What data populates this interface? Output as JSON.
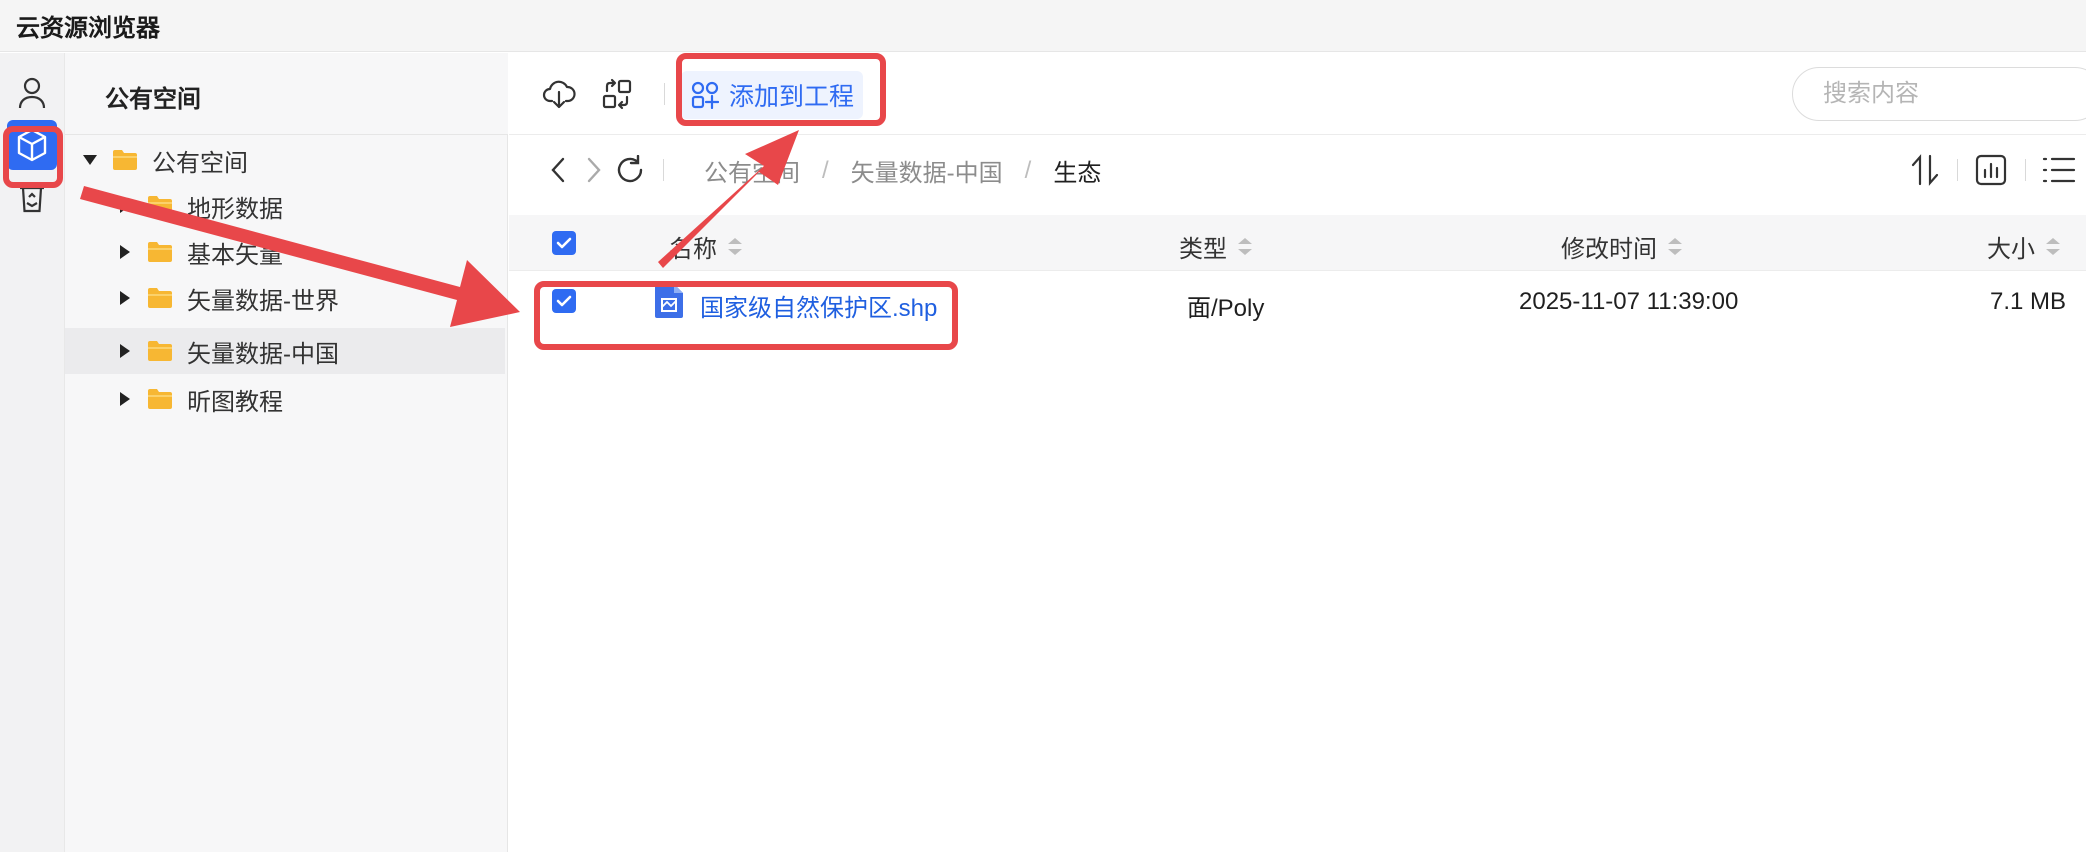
{
  "window": {
    "title": "云资源浏览器"
  },
  "rail": {
    "items": [
      {
        "icon": "user-icon"
      },
      {
        "icon": "cube-icon",
        "active": true
      },
      {
        "icon": "recycle-bin-icon"
      }
    ]
  },
  "tree": {
    "header": "公有空间",
    "root": {
      "label": "公有空间",
      "expanded": true
    },
    "children": [
      {
        "label": "地形数据"
      },
      {
        "label": "基本矢量"
      },
      {
        "label": "矢量数据-世界"
      },
      {
        "label": "矢量数据-中国",
        "selected": true
      },
      {
        "label": "昕图教程"
      }
    ]
  },
  "toolbar": {
    "add_to_project": "添加到工程",
    "search_placeholder": "搜索内容"
  },
  "breadcrumb": {
    "items": [
      "公有空间",
      "矢量数据-中国"
    ],
    "current": "生态"
  },
  "table": {
    "columns": {
      "name": "名称",
      "type": "类型",
      "modified": "修改时间",
      "size": "大小"
    },
    "rows": [
      {
        "checked": true,
        "name": "国家级自然保护区.shp",
        "type": "面/Poly",
        "modified": "2025-11-07 11:39:00",
        "size": "7.1 MB"
      }
    ]
  },
  "colors": {
    "accent": "#2f6bf2",
    "annotation": "#e8474a",
    "folder": "#f7b733"
  }
}
